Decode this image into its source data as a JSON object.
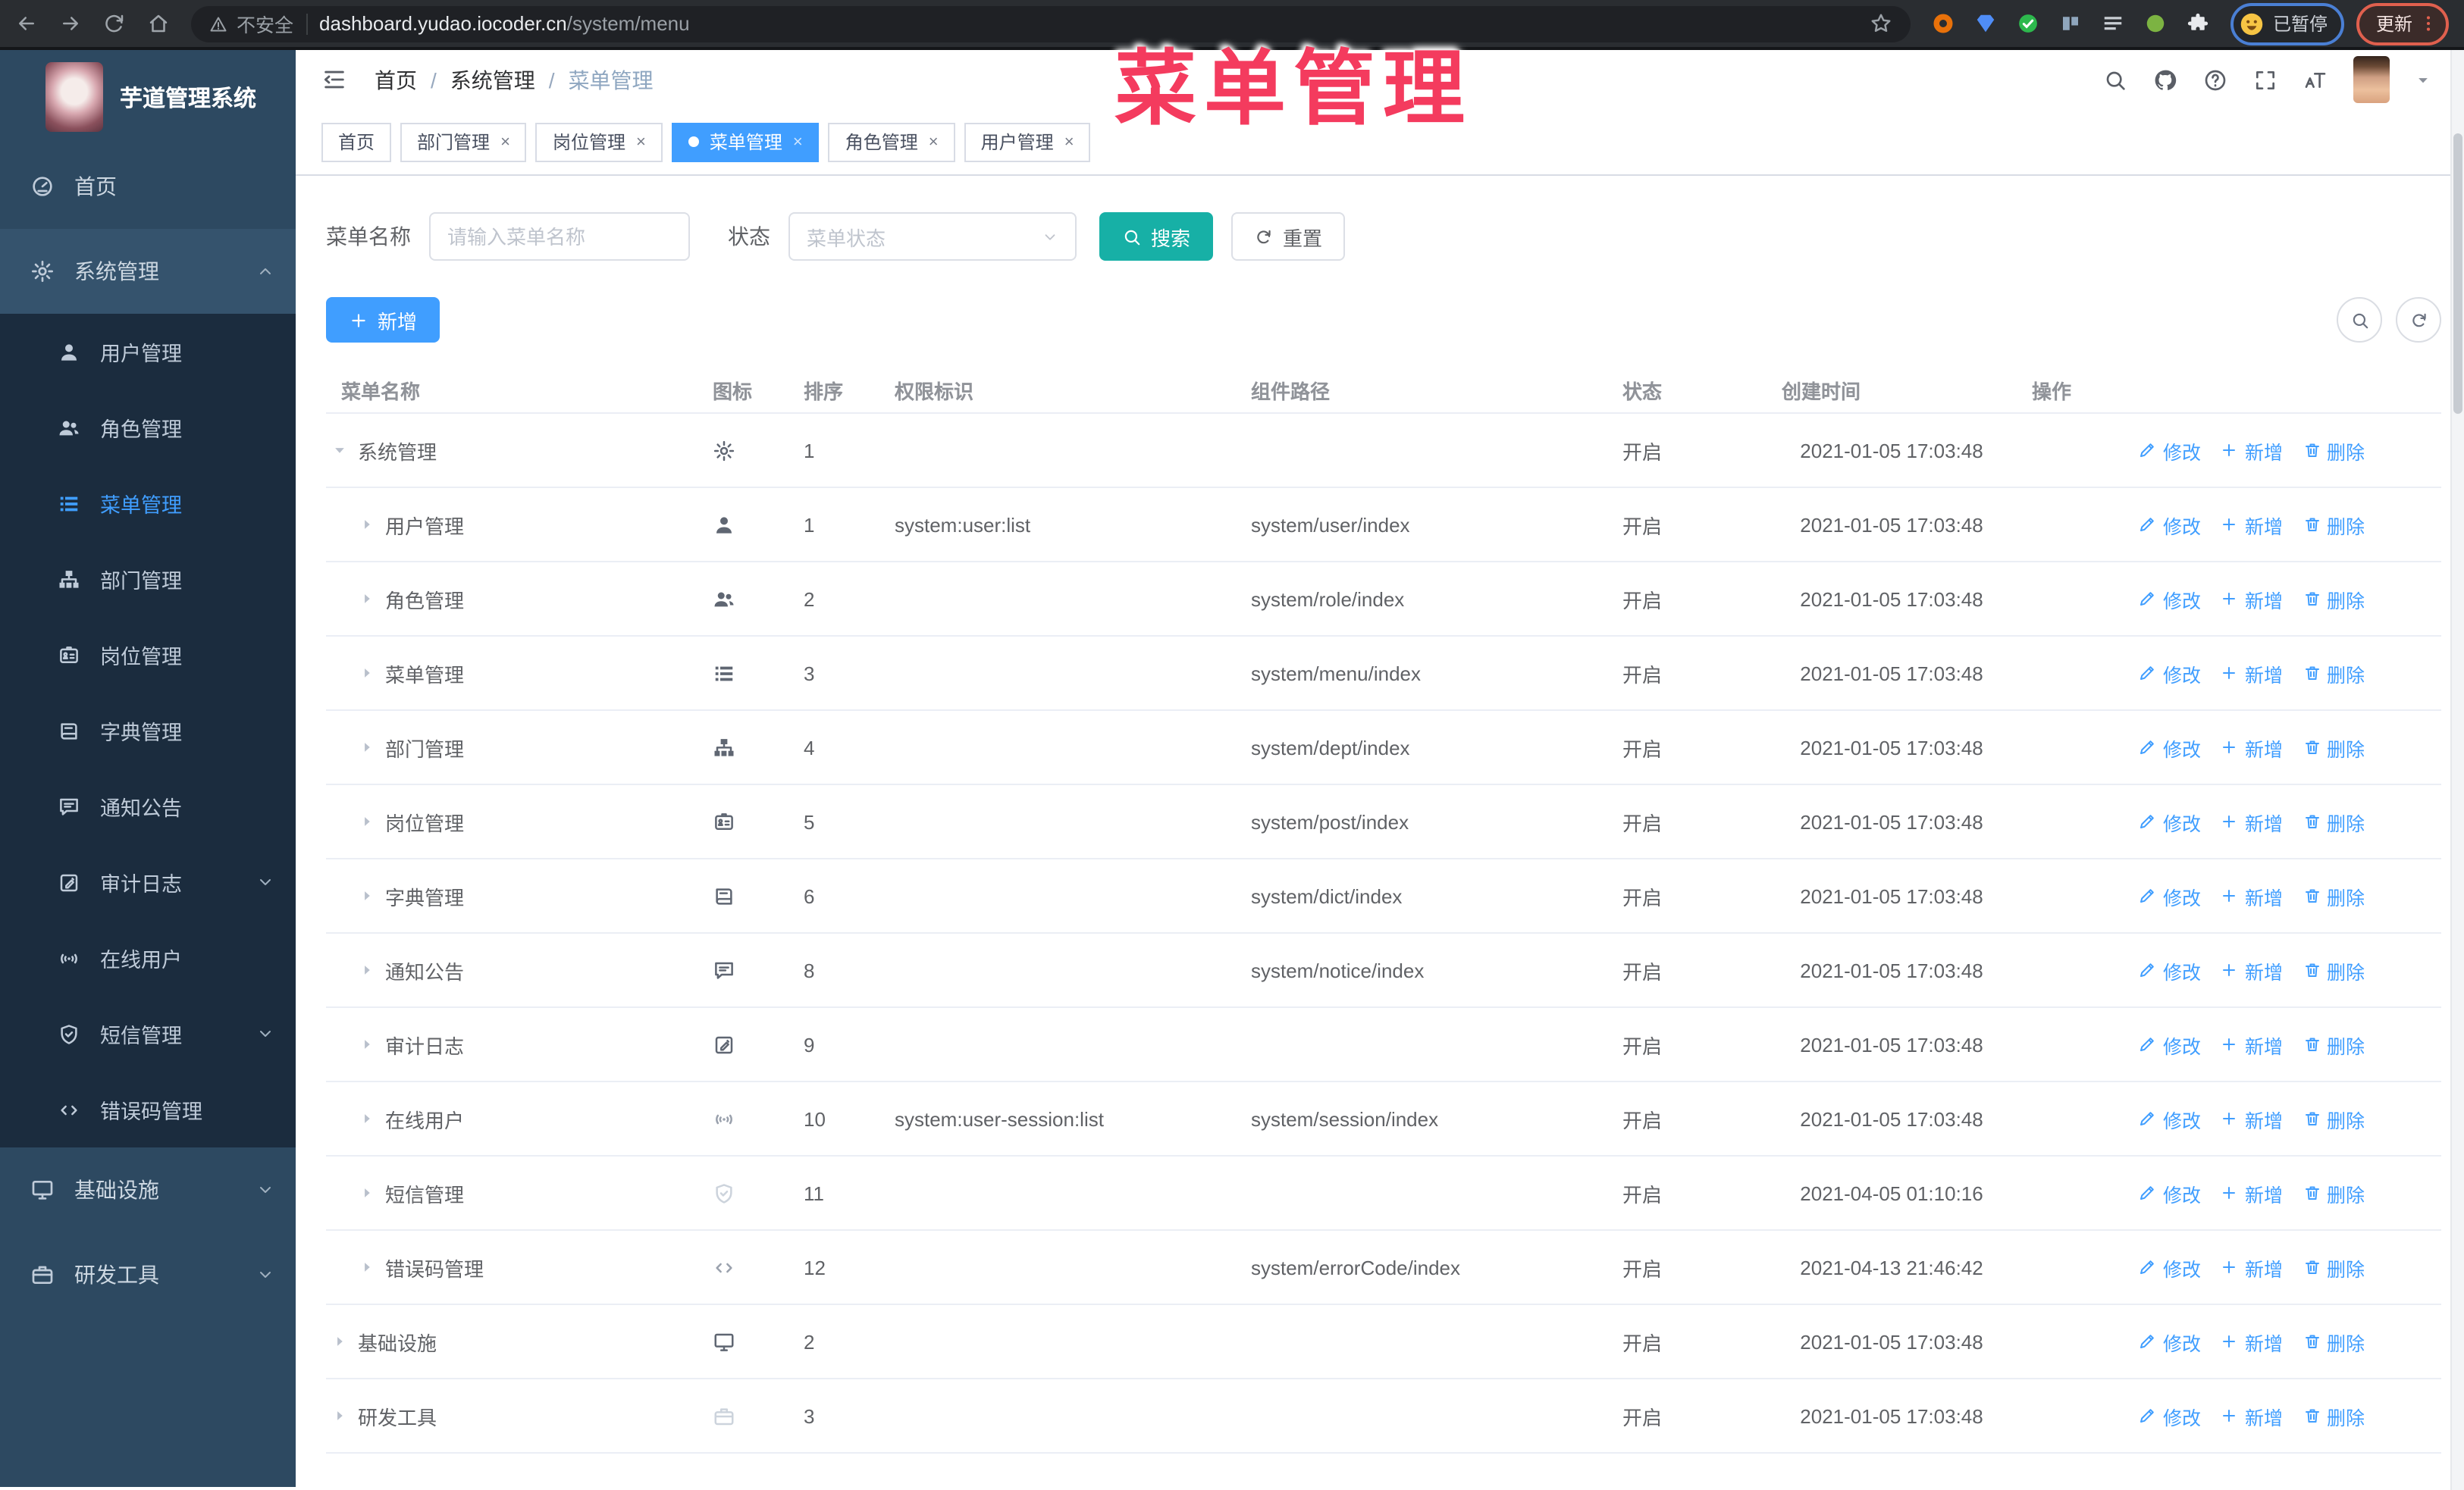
{
  "watermark": {
    "text": "菜单管理",
    "color": "#f43b5e"
  },
  "browser": {
    "nav_icons": [
      {
        "icon": "back-arrow-icon"
      },
      {
        "icon": "forward-arrow-icon"
      },
      {
        "icon": "reload-icon"
      },
      {
        "icon": "home-icon"
      }
    ],
    "security_label": "不安全",
    "url_domain": "dashboard.yudao.iocoder.cn",
    "url_path": "/system/menu",
    "extensions": [
      {
        "name": "extension-ring-icon",
        "icon": "ring-icon",
        "color": "#e8710a"
      },
      {
        "name": "extension-gem-icon",
        "icon": "gem-icon",
        "color": "#4f8df7"
      },
      {
        "name": "extension-check-icon",
        "icon": "disc-check-icon",
        "color": "#2db84d"
      },
      {
        "name": "extension-columns-icon",
        "icon": "cols-icon",
        "color": "#8fa6bd"
      },
      {
        "name": "extension-bars-icon",
        "icon": "bars-icon",
        "color": "#c9ced4",
        "badge": "on",
        "badge_color": "#21a453"
      },
      {
        "name": "extension-leaf-icon",
        "icon": "disc-icon",
        "color": "#7cb342"
      },
      {
        "name": "extension-puzzle-icon",
        "icon": "puzzle-icon",
        "color": "#e8eaed"
      }
    ],
    "profile_badge": {
      "label": "已暂停",
      "ring_color": "#4a7fd4"
    },
    "update_button": {
      "label": "更新",
      "color": "#e0604e"
    }
  },
  "sidebar": {
    "logo_title": "芋道管理系统",
    "top_items": [
      {
        "label": "首页",
        "icon": "dashboard-icon"
      },
      {
        "label": "系统管理",
        "icon": "gear-icon",
        "chevron": "up",
        "active_parent": true
      }
    ],
    "system_children": [
      {
        "label": "用户管理",
        "icon": "user-icon"
      },
      {
        "label": "角色管理",
        "icon": "users-icon"
      },
      {
        "label": "菜单管理",
        "icon": "menu-list-icon",
        "active": true
      },
      {
        "label": "部门管理",
        "icon": "org-tree-icon"
      },
      {
        "label": "岗位管理",
        "icon": "id-badge-icon"
      },
      {
        "label": "字典管理",
        "icon": "book-icon"
      },
      {
        "label": "通知公告",
        "icon": "megaphone-icon"
      },
      {
        "label": "审计日志",
        "icon": "log-edit-icon",
        "chevron": "down"
      },
      {
        "label": "在线用户",
        "icon": "online-signal-icon"
      },
      {
        "label": "短信管理",
        "icon": "shield-check-icon",
        "chevron": "down"
      },
      {
        "label": "错误码管理",
        "icon": "code-icon"
      }
    ],
    "bottom_items": [
      {
        "label": "基础设施",
        "icon": "monitor-icon",
        "chevron": "down"
      },
      {
        "label": "研发工具",
        "icon": "briefcase-icon",
        "chevron": "down"
      }
    ]
  },
  "header": {
    "breadcrumb": [
      {
        "sep": "",
        "label": "首页"
      },
      {
        "sep": "/",
        "label": "系统管理"
      },
      {
        "sep": "/",
        "label": "菜单管理",
        "last": true
      }
    ],
    "right_icons": [
      {
        "icon": "search-icon"
      },
      {
        "icon": "github-icon"
      },
      {
        "icon": "question-icon"
      },
      {
        "icon": "fullscreen-icon"
      },
      {
        "icon": "fontsize-icon"
      }
    ]
  },
  "tabs": {
    "close_glyph": "×",
    "items": [
      {
        "label": "首页",
        "closable": false,
        "active": false
      },
      {
        "label": "部门管理",
        "closable": true,
        "active": false
      },
      {
        "label": "岗位管理",
        "closable": true,
        "active": false
      },
      {
        "label": "菜单管理",
        "closable": true,
        "active": true
      },
      {
        "label": "角色管理",
        "closable": true,
        "active": false
      },
      {
        "label": "用户管理",
        "closable": true,
        "active": false
      }
    ]
  },
  "filters": {
    "name_label": "菜单名称",
    "name_placeholder": "请输入菜单名称",
    "status_label": "状态",
    "status_placeholder": "菜单状态",
    "search_label": "搜索",
    "reset_label": "重置"
  },
  "toolbar": {
    "add_label": "新增"
  },
  "table": {
    "columns": [
      "菜单名称",
      "图标",
      "排序",
      "权限标识",
      "组件路径",
      "状态",
      "创建时间",
      "操作"
    ],
    "action_labels": {
      "edit": "修改",
      "add": "新增",
      "delete": "删除"
    },
    "rows": [
      {
        "name": "系统管理",
        "child": false,
        "expanded": true,
        "icon": "gear-icon",
        "sort": "1",
        "permission": "",
        "path": "",
        "status": "开启",
        "time": "2021-01-05 17:03:48"
      },
      {
        "name": "用户管理",
        "child": true,
        "icon": "user-icon",
        "sort": "1",
        "permission": "system:user:list",
        "path": "system/user/index",
        "status": "开启",
        "time": "2021-01-05 17:03:48"
      },
      {
        "name": "角色管理",
        "child": true,
        "icon": "users-icon",
        "sort": "2",
        "permission": "",
        "path": "system/role/index",
        "status": "开启",
        "time": "2021-01-05 17:03:48"
      },
      {
        "name": "菜单管理",
        "child": true,
        "icon": "menu-list-icon",
        "sort": "3",
        "permission": "",
        "path": "system/menu/index",
        "status": "开启",
        "time": "2021-01-05 17:03:48"
      },
      {
        "name": "部门管理",
        "child": true,
        "icon": "org-tree-icon",
        "sort": "4",
        "permission": "",
        "path": "system/dept/index",
        "status": "开启",
        "time": "2021-01-05 17:03:48"
      },
      {
        "name": "岗位管理",
        "child": true,
        "icon": "id-badge-icon",
        "sort": "5",
        "permission": "",
        "path": "system/post/index",
        "status": "开启",
        "time": "2021-01-05 17:03:48"
      },
      {
        "name": "字典管理",
        "child": true,
        "icon": "book-icon",
        "sort": "6",
        "permission": "",
        "path": "system/dict/index",
        "status": "开启",
        "time": "2021-01-05 17:03:48"
      },
      {
        "name": "通知公告",
        "child": true,
        "icon": "megaphone-icon",
        "sort": "8",
        "permission": "",
        "path": "system/notice/index",
        "status": "开启",
        "time": "2021-01-05 17:03:48"
      },
      {
        "name": "审计日志",
        "child": true,
        "icon": "log-edit-icon",
        "sort": "9",
        "permission": "",
        "path": "",
        "status": "开启",
        "time": "2021-01-05 17:03:48"
      },
      {
        "name": "在线用户",
        "child": true,
        "icon": "online-signal-icon",
        "icon_mid": true,
        "sort": "10",
        "permission": "system:user-session:list",
        "path": "system/session/index",
        "status": "开启",
        "time": "2021-01-05 17:03:48"
      },
      {
        "name": "短信管理",
        "child": true,
        "icon": "shield-check-icon",
        "icon_light": true,
        "sort": "11",
        "permission": "",
        "path": "",
        "status": "开启",
        "time": "2021-04-05 01:10:16"
      },
      {
        "name": "错误码管理",
        "child": true,
        "icon": "code-icon",
        "icon_mid": true,
        "sort": "12",
        "permission": "",
        "path": "system/errorCode/index",
        "status": "开启",
        "time": "2021-04-13 21:46:42"
      },
      {
        "name": "基础设施",
        "child": false,
        "expanded": false,
        "icon": "monitor-icon",
        "sort": "2",
        "permission": "",
        "path": "",
        "status": "开启",
        "time": "2021-01-05 17:03:48"
      },
      {
        "name": "研发工具",
        "child": false,
        "expanded": false,
        "icon": "briefcase-icon",
        "icon_light": true,
        "sort": "3",
        "permission": "",
        "path": "",
        "status": "开启",
        "time": "2021-01-05 17:03:48"
      }
    ]
  },
  "colors": {
    "primary": "#409eff",
    "search_button": "#17b0a6",
    "sidebar_bg": "#2d4961",
    "submenu_bg": "#1b2c3e",
    "watermark": "#f43b5e",
    "active_tab": "#409eff"
  }
}
